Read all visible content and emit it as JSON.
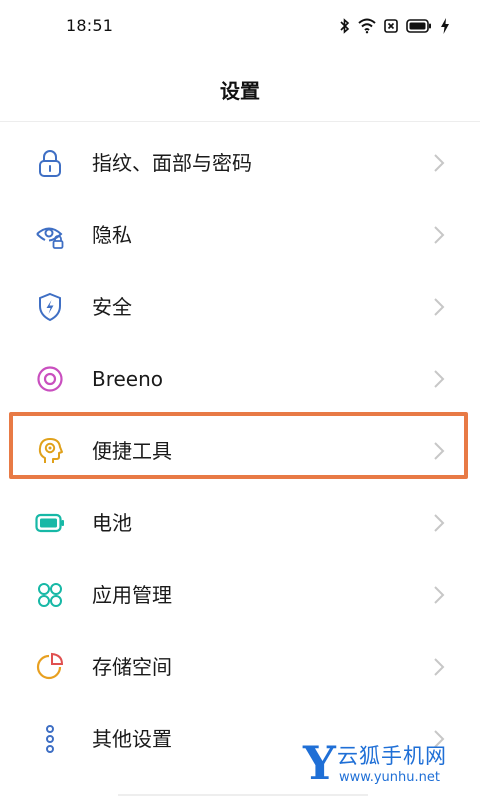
{
  "status_bar": {
    "time": "18:51",
    "icons": [
      "bluetooth-icon",
      "wifi-icon",
      "sim-off-icon",
      "battery-icon",
      "charging-icon"
    ]
  },
  "header": {
    "title": "设置"
  },
  "settings": {
    "items": [
      {
        "label": "指纹、面部与密码",
        "icon": "lock-icon",
        "color": "#3f6fc4"
      },
      {
        "label": "隐私",
        "icon": "privacy-eye-icon",
        "color": "#3f6fc4"
      },
      {
        "label": "安全",
        "icon": "shield-icon",
        "color": "#3f6fc4"
      },
      {
        "label": "Breeno",
        "icon": "breeno-icon",
        "color": "#c94fbf"
      },
      {
        "label": "便捷工具",
        "icon": "convenience-tools-icon",
        "color": "#e0a11b"
      },
      {
        "label": "电池",
        "icon": "battery-icon",
        "color": "#17b8a6"
      },
      {
        "label": "应用管理",
        "icon": "apps-icon",
        "color": "#17b8a6"
      },
      {
        "label": "存储空间",
        "icon": "storage-pie-icon",
        "color": "#e8a020"
      },
      {
        "label": "其他设置",
        "icon": "more-settings-icon",
        "color": "#3f6fc4"
      }
    ]
  },
  "highlight": {
    "target": "便捷工具",
    "color": "#e87a45"
  },
  "watermark": {
    "letter": "Y",
    "text": "云狐手机网",
    "url": "www.yunhu.net",
    "color": "#1f6fd6"
  }
}
